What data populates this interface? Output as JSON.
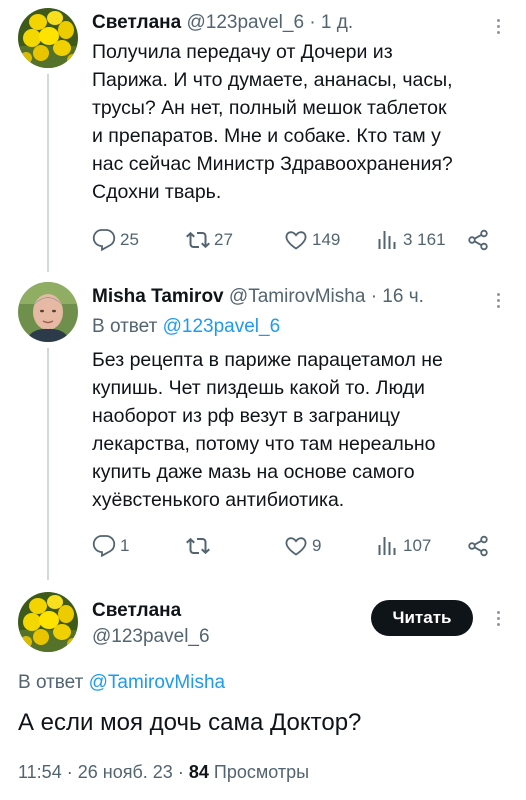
{
  "tweet1": {
    "display_name": "Светлана",
    "handle": "@123pavel_6",
    "sep": "·",
    "time": "1 д.",
    "text": "Получила передачу от Дочери из\nПарижа. И что думаете, ананасы, часы,\nтрусы? Ан нет, полный мешок таблеток\nи препаратов. Мне и собаке. Кто там у\nнас сейчас Министр Здравоохранения?\nСдохни тварь.",
    "replies": "25",
    "retweets": "27",
    "likes": "149",
    "views": "3 161"
  },
  "tweet2": {
    "display_name": "Misha Tamirov",
    "handle": "@TamirovMisha",
    "sep": "·",
    "time": "16 ч.",
    "reply_prefix": "В ответ",
    "reply_handle": "@123pavel_6",
    "text": "Без рецепта в париже парацетамол не\nкупишь. Чет пиздешь какой то. Люди\nнаоборот из рф везут в заграницу\nлекарства, потому что там нереально\nкупить даже мазь на основе самого\nхуёвстенького антибиотика.",
    "replies": "1",
    "retweets": "",
    "likes": "9",
    "views": "107"
  },
  "main_tweet": {
    "display_name": "Светлана",
    "handle": "@123pavel_6",
    "follow_label": "Читать",
    "reply_prefix": "В ответ",
    "reply_handle": "@TamirovMisha",
    "text": "А если моя дочь сама Доктор?",
    "time": "11:54",
    "sep1": "·",
    "date": "26 нояб. 23",
    "sep2": "·",
    "views_count": "84",
    "views_label": "Просмотры"
  },
  "colors": {
    "accent": "#1d9bf0",
    "muted": "#536471",
    "text": "#0f1419",
    "thread_line": "#cfd9de"
  }
}
